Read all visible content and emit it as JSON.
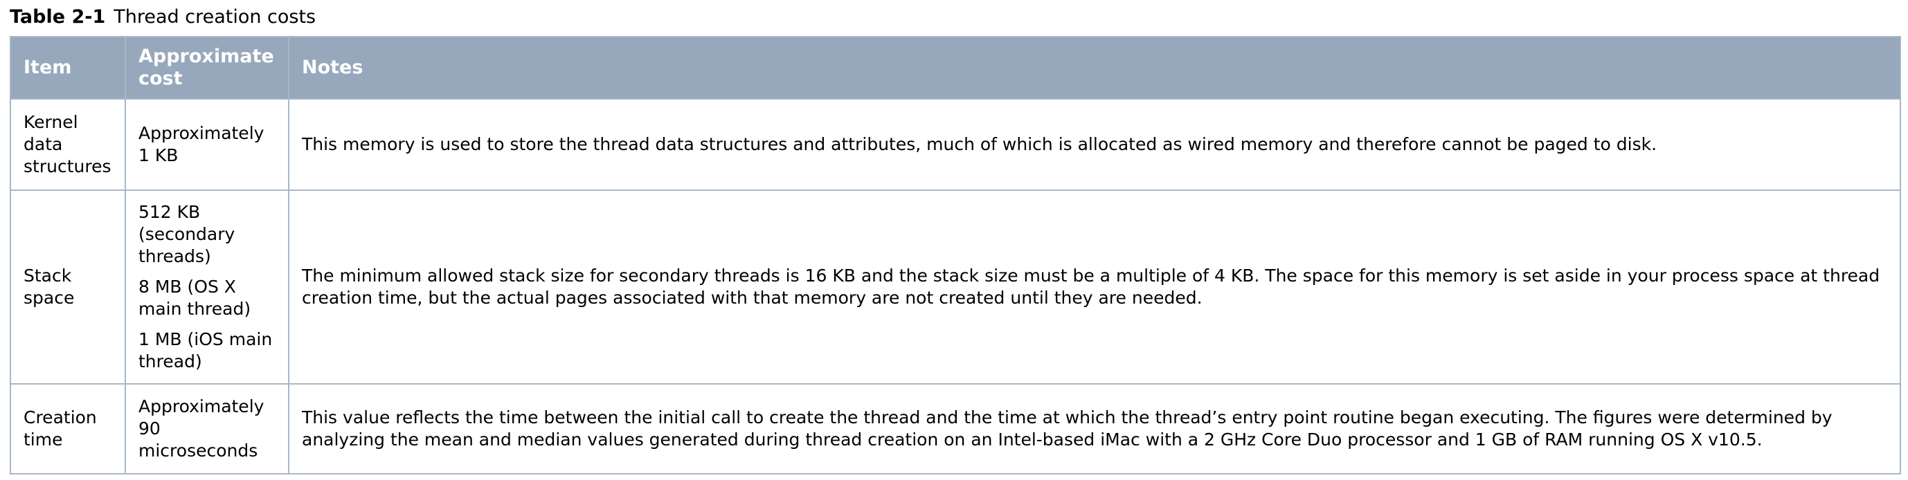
{
  "caption": {
    "number": "Table 2-1",
    "title": "Thread creation costs"
  },
  "table": {
    "headers": {
      "item": "Item",
      "cost": "Approximate cost",
      "notes": "Notes"
    },
    "rows": [
      {
        "item": "Kernel data structures",
        "cost": [
          "Approximately 1 KB"
        ],
        "notes": "This memory is used to store the thread data structures and attributes, much of which is allocated as wired memory and therefore cannot be paged to disk."
      },
      {
        "item": "Stack space",
        "cost": [
          "512 KB (secondary threads)",
          "8 MB (OS X main thread)",
          "1 MB (iOS main thread)"
        ],
        "notes": "The minimum allowed stack size for secondary threads is 16 KB and the stack size must be a multiple of 4 KB. The space for this memory is set aside in your process space at thread creation time, but the actual pages associated with that memory are not created until they are needed."
      },
      {
        "item": "Creation time",
        "cost": [
          "Approximately 90 microseconds"
        ],
        "notes": "This value reflects the time between the initial call to create the thread and the time at which the thread’s entry point routine began executing. The figures were determined by analyzing the mean and median values generated during thread creation on an Intel-based iMac with a 2 GHz Core Duo processor and 1 GB of RAM running OS X v10.5."
      }
    ]
  },
  "colors": {
    "header_background": "#97a8bc",
    "header_text": "#ffffff",
    "border": "#a8b7c9"
  }
}
